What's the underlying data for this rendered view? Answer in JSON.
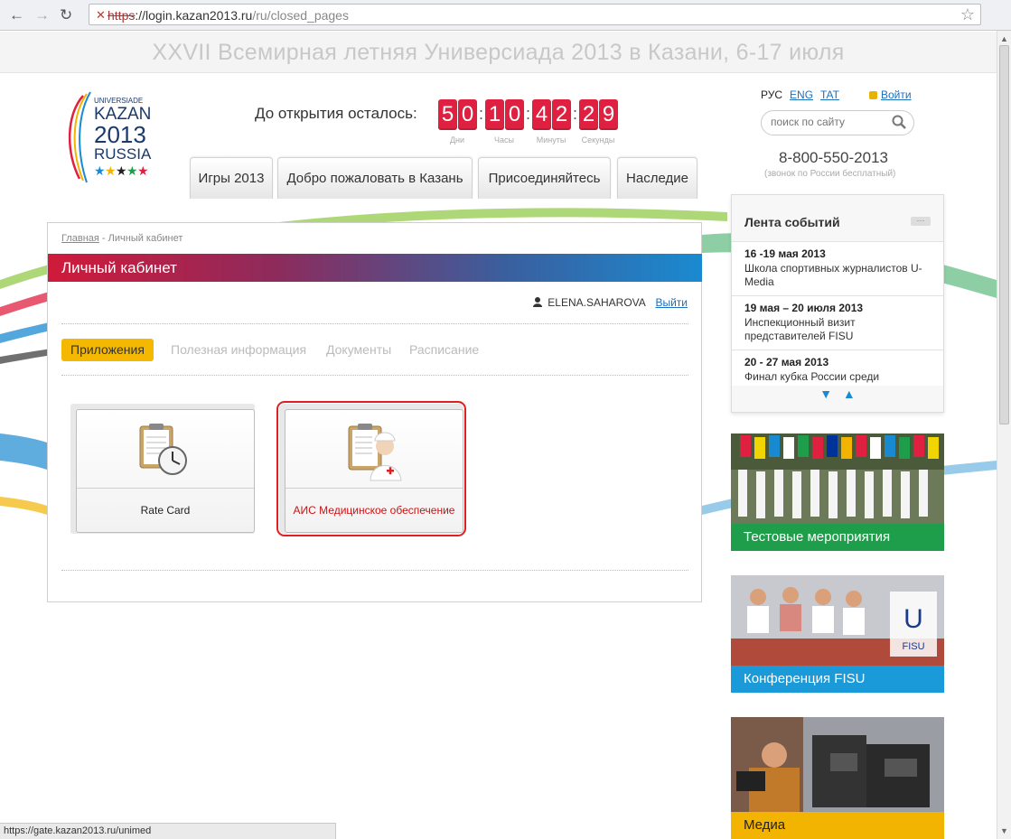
{
  "browser": {
    "url_scheme": "https",
    "url_host": "://login.kazan2013.ru",
    "url_path": "/ru/closed_pages",
    "status_url": "https://gate.kazan2013.ru/unimed"
  },
  "banner": {
    "title": "XXVII Всемирная летняя Универсиада 2013 в Казани, 6-17 июля"
  },
  "logo": {
    "line1": "UNIVERSIADE",
    "line2": "KAZAN",
    "line3": "2013",
    "line4": "RUSSIA"
  },
  "countdown": {
    "label": "До открытия осталось:",
    "days": [
      "5",
      "0"
    ],
    "hours": [
      "1",
      "0"
    ],
    "minutes": [
      "4",
      "2"
    ],
    "seconds": [
      "2",
      "9"
    ],
    "units": {
      "days": "Дни",
      "hours": "Часы",
      "minutes": "Минуты",
      "seconds": "Секунды"
    }
  },
  "menu": [
    "Игры 2013",
    "Добро пожаловать в Казань",
    "Присоединяйтесь",
    "Наследие"
  ],
  "lang": {
    "rus": "РУС",
    "eng": "ENG",
    "tat": "TAT"
  },
  "login_label": "Войти",
  "search": {
    "placeholder": "поиск по сайту"
  },
  "phone": {
    "number": "8-800-550-2013",
    "note": "(звонок по России бесплатный)"
  },
  "breadcrumb": {
    "home": "Главная",
    "sep": " - ",
    "current": "Личный кабинет"
  },
  "page_title": "Личный кабинет",
  "user": {
    "name": "ELENA.SAHAROVA",
    "logout": "Выйти"
  },
  "tabs": [
    "Приложения",
    "Полезная информация",
    "Документы",
    "Расписание"
  ],
  "apps": [
    {
      "label": "Rate Card",
      "icon": "clipboard-clock-icon"
    },
    {
      "label": "АИС Медицинское обеспечение",
      "icon": "clipboard-nurse-icon"
    }
  ],
  "events": {
    "title": "Лента событий",
    "more": "···",
    "items": [
      {
        "date": "16 -19 мая 2013",
        "text": "Школа спортивных журналистов U-Media"
      },
      {
        "date": "19 мая – 20 июля 2013",
        "text": "Инспекционный визит представителей FISU"
      },
      {
        "date": "20 - 27 мая 2013",
        "text": "Финал кубка России среди"
      }
    ]
  },
  "promos": [
    {
      "label": "Тестовые мероприятия",
      "color": "#1e9e4a"
    },
    {
      "label": "Конференция FISU",
      "color": "#1a9ad8"
    },
    {
      "label": "Медиа",
      "color": "#f2b400"
    }
  ]
}
